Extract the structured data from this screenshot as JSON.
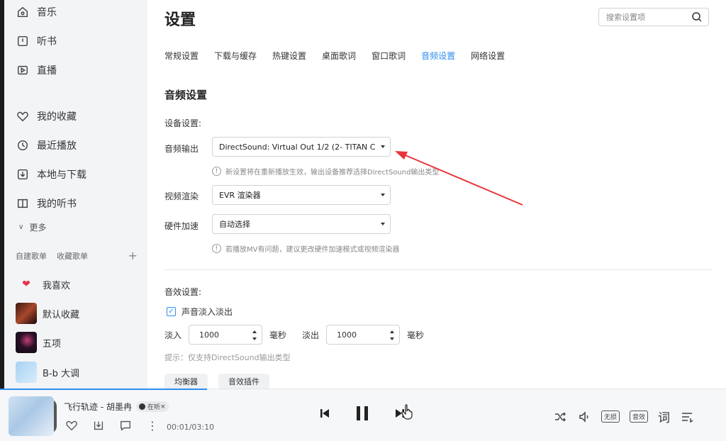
{
  "sidebar": {
    "nav": [
      {
        "label": "音乐",
        "icon": "home-icon"
      },
      {
        "label": "听书",
        "icon": "book-icon"
      },
      {
        "label": "直播",
        "icon": "live-icon"
      },
      {
        "label": "我的收藏",
        "icon": "heart-icon"
      },
      {
        "label": "最近播放",
        "icon": "clock-icon"
      },
      {
        "label": "本地与下载",
        "icon": "download-icon"
      },
      {
        "label": "我的听书",
        "icon": "audiobook-icon"
      }
    ],
    "more_label": "更多",
    "playlist_tabs": [
      "自建歌单",
      "收藏歌单"
    ],
    "playlists": [
      {
        "label": "我喜欢"
      },
      {
        "label": "默认收藏"
      },
      {
        "label": "五项"
      },
      {
        "label": "B-b 大调"
      }
    ]
  },
  "main": {
    "title": "设置",
    "search_placeholder": "搜索设置项",
    "tabs": [
      "常规设置",
      "下载与缓存",
      "热键设置",
      "桌面歌词",
      "窗口歌词",
      "音频设置",
      "网络设置"
    ],
    "active_tab": "音频设置",
    "section_title": "音频设置",
    "device_label": "设备设置:",
    "audio_output_label": "音频输出",
    "audio_output_value": "DirectSound: Virtual Out 1/2 (2- TITAN C",
    "audio_output_hint": "新设置将在重新播放生效，输出设备推荐选择DirectSound输出类型",
    "video_render_label": "视频渲染",
    "video_render_value": "EVR 渲染器",
    "hw_accel_label": "硬件加速",
    "hw_accel_value": "自动选择",
    "hw_accel_hint": "若播放MV有问题，建议更改硬件加速模式或视频渲染器",
    "effects_label": "音效设置:",
    "fade_checkbox_label": "声音淡入淡出",
    "fade_in_label": "淡入",
    "fade_in_value": "1000",
    "fade_out_label": "淡出",
    "fade_out_value": "1000",
    "ms_unit": "毫秒",
    "tip": "提示：仅支持DirectSound输出类型",
    "equalizer_button": "均衡器",
    "effects_plugin_button": "音效插件"
  },
  "player": {
    "song": "飞行轨迹 - 胡墨冉",
    "tag": "在听",
    "time": "00:01/03:10",
    "sound_effect_badge": "无损",
    "quality_badge": "音效",
    "lyrics_label": "词",
    "progress_fraction": 0.005
  },
  "colors": {
    "accent": "#2f8df0",
    "annotation": "#e8343c"
  }
}
